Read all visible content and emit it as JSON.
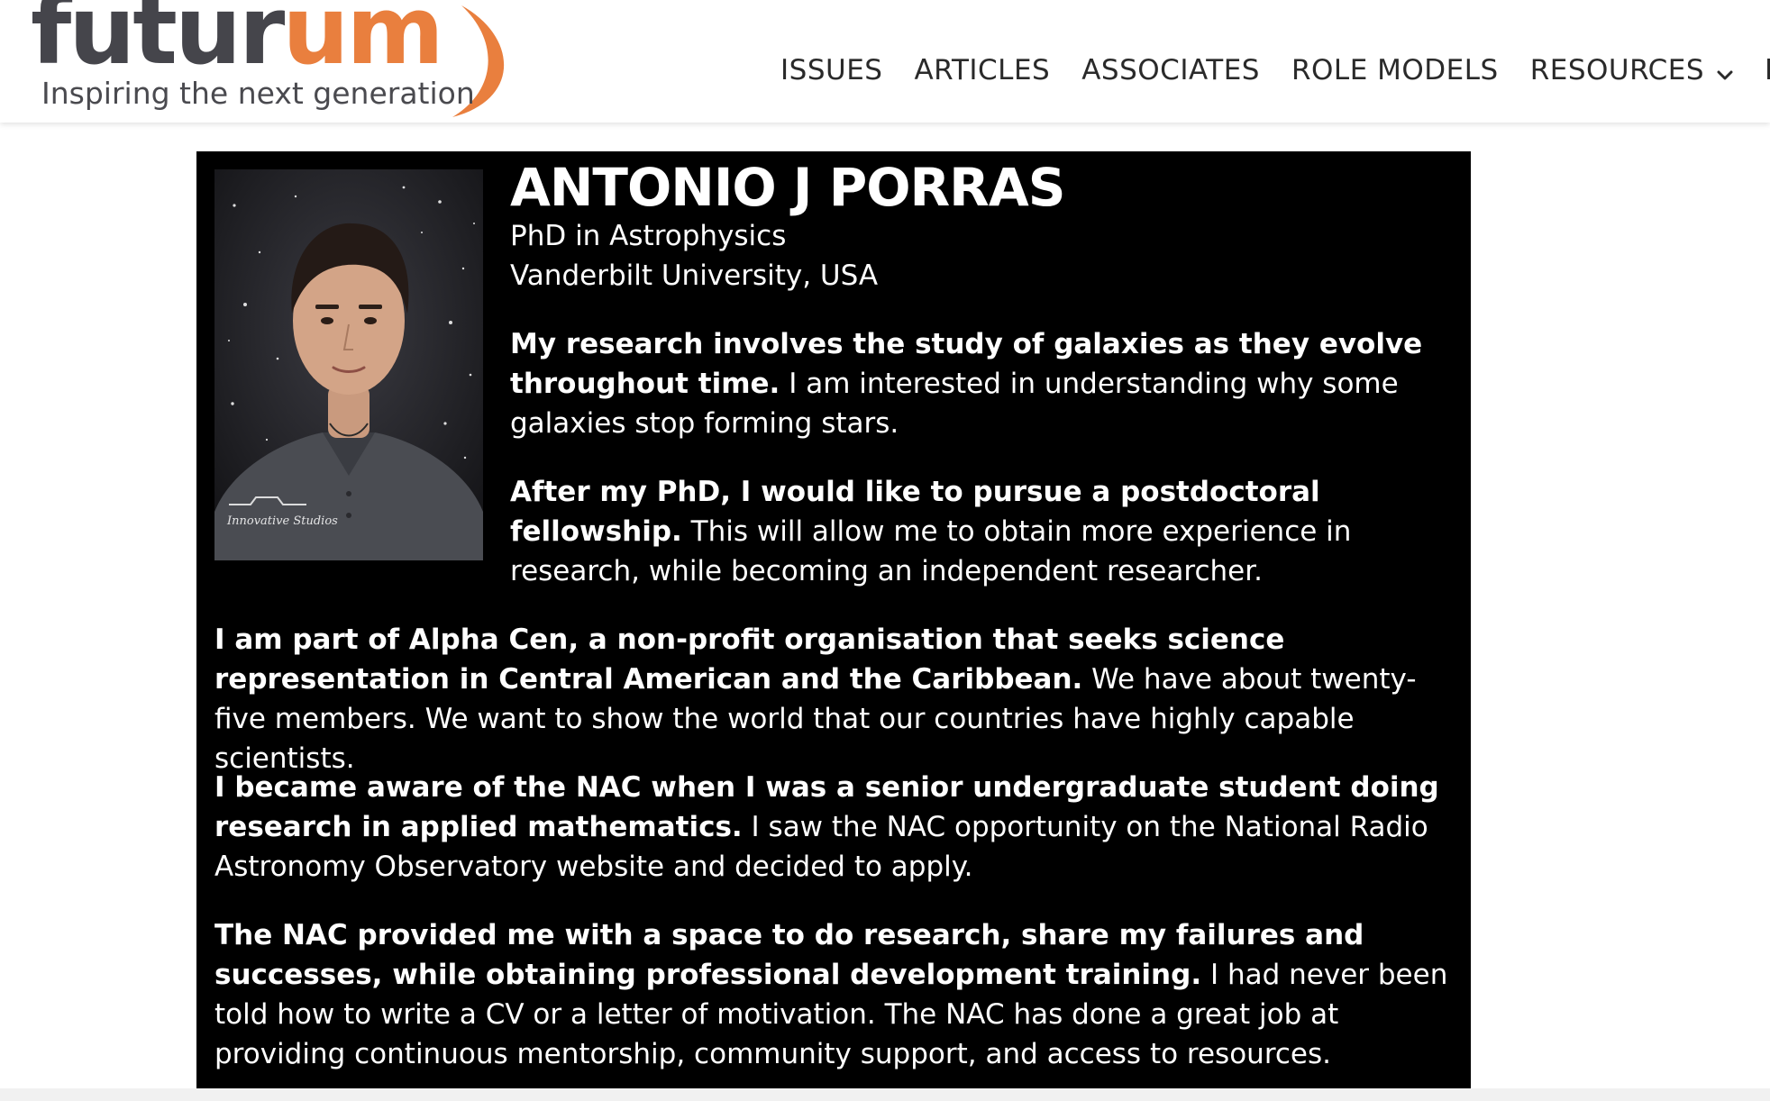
{
  "logo": {
    "word_dark": "futur",
    "word_accent": "um",
    "tagline": "Inspiring the next generation"
  },
  "nav": {
    "items": [
      {
        "label": "ISSUES"
      },
      {
        "label": "ARTICLES"
      },
      {
        "label": "ASSOCIATES"
      },
      {
        "label": "ROLE MODELS"
      },
      {
        "label": "RESOURCES"
      },
      {
        "label": "BL"
      }
    ]
  },
  "profile": {
    "name": "ANTONIO J PORRAS",
    "degree": "PhD in Astrophysics",
    "university": "Vanderbilt University, USA",
    "photo_watermark": "Innovative Studios",
    "paragraphs": [
      {
        "lead": "My research involves the study of galaxies as they evolve throughout time.",
        "rest": " I am interested in understanding why some galaxies stop forming stars."
      },
      {
        "lead": "After my PhD, I would like to pursue a postdoctoral fellowship.",
        "rest": " This will allow me to obtain more experience in research, while becoming an independent researcher."
      },
      {
        "lead": "I am part of Alpha Cen, a non-profit organisation that seeks science representation in Central American and the Caribbean.",
        "rest": " We have about twenty-five members. We want to show the world that our countries have highly capable scientists."
      },
      {
        "lead": "I became aware of the NAC when I was a senior undergraduate student doing research in applied mathematics.",
        "rest": " I saw the NAC opportunity on the National Radio Astronomy Observatory website and decided to apply."
      },
      {
        "lead": "The NAC provided me with a space to do research, share my failures and successes, while obtaining professional development training.",
        "rest": " I had never been told how to write a CV or a letter of motivation. The NAC has done a great job at providing continuous mentorship, community support, and access to resources."
      }
    ]
  },
  "colors": {
    "brand_orange": "#e97f3e",
    "brand_gray": "#45454b",
    "card_background": "#000000",
    "card_text": "#ffffff"
  },
  "icons": {
    "resources_dropdown": "chevron-down-icon"
  }
}
